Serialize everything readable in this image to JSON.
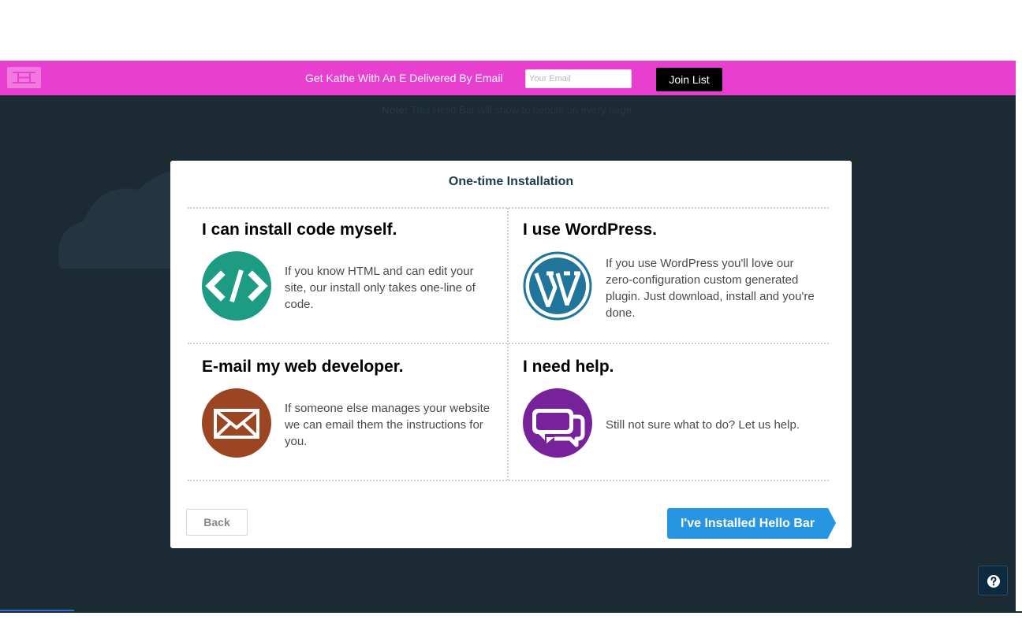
{
  "hello_bar": {
    "logo_icon": "hello-bar-logo-icon",
    "message": "Get Kathe With An E Delivered By Email",
    "email_placeholder": "Your Email",
    "join_label": "Join List",
    "background_color": "#e93fd1"
  },
  "backdrop": {
    "note_label": "Note:",
    "note_text": "This Hello Bar will show to people on every page"
  },
  "modal": {
    "title": "One-time Installation",
    "options": [
      {
        "heading": "I can install code myself.",
        "icon": "code-icon",
        "icon_color": "#1e9c83",
        "description": "If you know HTML and can edit your site, our install only takes one-line of code."
      },
      {
        "heading": "I use WordPress.",
        "icon": "wordpress-icon",
        "icon_color": "#21759b",
        "description": "If you use WordPress you'll love our zero-configuration custom generated plugin. Just download, install and you're done."
      },
      {
        "heading": "E-mail my web developer.",
        "icon": "envelope-icon",
        "icon_color": "#9b4523",
        "description": "If someone else manages your website we can email them the instructions for you."
      },
      {
        "heading": "I need help.",
        "icon": "chat-bubbles-icon",
        "icon_color": "#77229b",
        "description": "Still not sure what to do? Let us help."
      }
    ],
    "back_label": "Back",
    "installed_label": "I've Installed Hello Bar",
    "primary_color": "#2895e3"
  },
  "help": {
    "icon": "question-icon"
  }
}
